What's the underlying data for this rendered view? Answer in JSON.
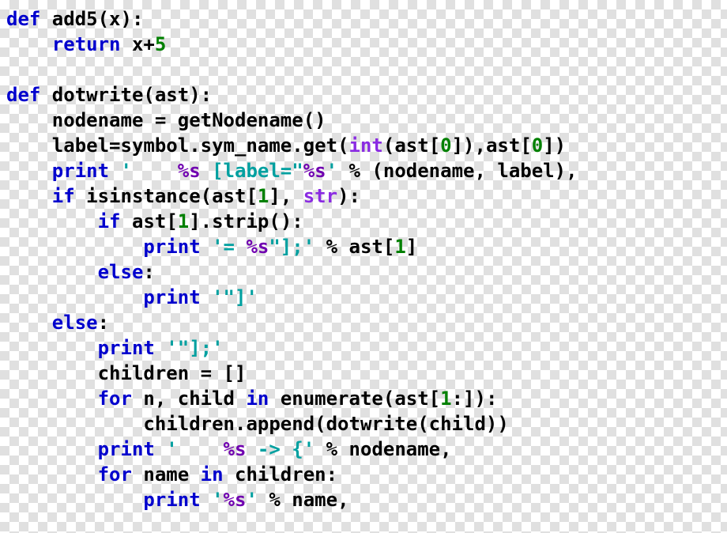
{
  "code": {
    "lines": [
      {
        "indent": 0,
        "tokens": [
          {
            "t": "def ",
            "c": "kw"
          },
          {
            "t": "add5",
            "c": "fn"
          },
          {
            "t": "(",
            "c": "par"
          },
          {
            "t": "x",
            "c": "fn"
          },
          {
            "t": ")",
            "c": "par"
          },
          {
            "t": ":",
            "c": "op"
          }
        ]
      },
      {
        "indent": 1,
        "tokens": [
          {
            "t": "return ",
            "c": "kw"
          },
          {
            "t": "x",
            "c": "fn"
          },
          {
            "t": "+",
            "c": "op"
          },
          {
            "t": "5",
            "c": "num"
          }
        ]
      },
      {
        "indent": 0,
        "tokens": []
      },
      {
        "indent": 0,
        "tokens": [
          {
            "t": "def ",
            "c": "kw"
          },
          {
            "t": "dotwrite",
            "c": "fn"
          },
          {
            "t": "(",
            "c": "par"
          },
          {
            "t": "ast",
            "c": "fn"
          },
          {
            "t": ")",
            "c": "par"
          },
          {
            "t": ":",
            "c": "op"
          }
        ]
      },
      {
        "indent": 1,
        "tokens": [
          {
            "t": "nodename ",
            "c": "fn"
          },
          {
            "t": "=",
            "c": "op"
          },
          {
            "t": " getNodename",
            "c": "fn"
          },
          {
            "t": "()",
            "c": "par"
          }
        ]
      },
      {
        "indent": 1,
        "tokens": [
          {
            "t": "label",
            "c": "fn"
          },
          {
            "t": "=",
            "c": "op"
          },
          {
            "t": "symbol",
            "c": "fn"
          },
          {
            "t": ".",
            "c": "op"
          },
          {
            "t": "sym_name",
            "c": "fn"
          },
          {
            "t": ".",
            "c": "op"
          },
          {
            "t": "get",
            "c": "fn"
          },
          {
            "t": "(",
            "c": "par"
          },
          {
            "t": "int",
            "c": "bi"
          },
          {
            "t": "(",
            "c": "par"
          },
          {
            "t": "ast",
            "c": "fn"
          },
          {
            "t": "[",
            "c": "par"
          },
          {
            "t": "0",
            "c": "num"
          },
          {
            "t": "]",
            "c": "par"
          },
          {
            "t": ")",
            "c": "par"
          },
          {
            "t": ",",
            "c": "op"
          },
          {
            "t": "ast",
            "c": "fn"
          },
          {
            "t": "[",
            "c": "par"
          },
          {
            "t": "0",
            "c": "num"
          },
          {
            "t": "]",
            "c": "par"
          },
          {
            "t": ")",
            "c": "par"
          }
        ]
      },
      {
        "indent": 1,
        "tokens": [
          {
            "t": "print ",
            "c": "kw"
          },
          {
            "t": "'    ",
            "c": "str"
          },
          {
            "t": "%s",
            "c": "fmt"
          },
          {
            "t": " [label=\"",
            "c": "str"
          },
          {
            "t": "%s",
            "c": "fmt"
          },
          {
            "t": "'",
            "c": "str"
          },
          {
            "t": " % ",
            "c": "op"
          },
          {
            "t": "(",
            "c": "par"
          },
          {
            "t": "nodename",
            "c": "fn"
          },
          {
            "t": ",",
            "c": "op"
          },
          {
            "t": " label",
            "c": "fn"
          },
          {
            "t": ")",
            "c": "par"
          },
          {
            "t": ",",
            "c": "op"
          }
        ]
      },
      {
        "indent": 1,
        "tokens": [
          {
            "t": "if ",
            "c": "kw"
          },
          {
            "t": "isinstance",
            "c": "fn"
          },
          {
            "t": "(",
            "c": "par"
          },
          {
            "t": "ast",
            "c": "fn"
          },
          {
            "t": "[",
            "c": "par"
          },
          {
            "t": "1",
            "c": "num"
          },
          {
            "t": "]",
            "c": "par"
          },
          {
            "t": ",",
            "c": "op"
          },
          {
            "t": " ",
            "c": "op"
          },
          {
            "t": "str",
            "c": "bi"
          },
          {
            "t": ")",
            "c": "par"
          },
          {
            "t": ":",
            "c": "op"
          }
        ]
      },
      {
        "indent": 2,
        "tokens": [
          {
            "t": "if ",
            "c": "kw"
          },
          {
            "t": "ast",
            "c": "fn"
          },
          {
            "t": "[",
            "c": "par"
          },
          {
            "t": "1",
            "c": "num"
          },
          {
            "t": "]",
            "c": "par"
          },
          {
            "t": ".",
            "c": "op"
          },
          {
            "t": "strip",
            "c": "fn"
          },
          {
            "t": "()",
            "c": "par"
          },
          {
            "t": ":",
            "c": "op"
          }
        ]
      },
      {
        "indent": 3,
        "tokens": [
          {
            "t": "print ",
            "c": "kw"
          },
          {
            "t": "'= ",
            "c": "str"
          },
          {
            "t": "%s",
            "c": "fmt"
          },
          {
            "t": "\"];'",
            "c": "str"
          },
          {
            "t": " % ",
            "c": "op"
          },
          {
            "t": "ast",
            "c": "fn"
          },
          {
            "t": "[",
            "c": "par"
          },
          {
            "t": "1",
            "c": "num"
          },
          {
            "t": "]",
            "c": "par"
          }
        ]
      },
      {
        "indent": 2,
        "tokens": [
          {
            "t": "else",
            "c": "kw"
          },
          {
            "t": ":",
            "c": "op"
          }
        ]
      },
      {
        "indent": 3,
        "tokens": [
          {
            "t": "print ",
            "c": "kw"
          },
          {
            "t": "'\"]'",
            "c": "str"
          }
        ]
      },
      {
        "indent": 1,
        "tokens": [
          {
            "t": "else",
            "c": "kw"
          },
          {
            "t": ":",
            "c": "op"
          }
        ]
      },
      {
        "indent": 2,
        "tokens": [
          {
            "t": "print ",
            "c": "kw"
          },
          {
            "t": "'\"];'",
            "c": "str"
          }
        ]
      },
      {
        "indent": 2,
        "tokens": [
          {
            "t": "children ",
            "c": "fn"
          },
          {
            "t": "=",
            "c": "op"
          },
          {
            "t": " []",
            "c": "par"
          }
        ]
      },
      {
        "indent": 2,
        "tokens": [
          {
            "t": "for ",
            "c": "kw"
          },
          {
            "t": "n",
            "c": "fn"
          },
          {
            "t": ",",
            "c": "op"
          },
          {
            "t": " child ",
            "c": "fn"
          },
          {
            "t": "in ",
            "c": "kw"
          },
          {
            "t": "enumerate",
            "c": "fn"
          },
          {
            "t": "(",
            "c": "par"
          },
          {
            "t": "ast",
            "c": "fn"
          },
          {
            "t": "[",
            "c": "par"
          },
          {
            "t": "1",
            "c": "num"
          },
          {
            "t": ":",
            "c": "op"
          },
          {
            "t": "]",
            "c": "par"
          },
          {
            "t": ")",
            "c": "par"
          },
          {
            "t": ":",
            "c": "op"
          }
        ]
      },
      {
        "indent": 3,
        "tokens": [
          {
            "t": "children",
            "c": "fn"
          },
          {
            "t": ".",
            "c": "op"
          },
          {
            "t": "append",
            "c": "fn"
          },
          {
            "t": "(",
            "c": "par"
          },
          {
            "t": "dotwrite",
            "c": "fn"
          },
          {
            "t": "(",
            "c": "par"
          },
          {
            "t": "child",
            "c": "fn"
          },
          {
            "t": ")",
            "c": "par"
          },
          {
            "t": ")",
            "c": "par"
          }
        ]
      },
      {
        "indent": 2,
        "tokens": [
          {
            "t": "print ",
            "c": "kw"
          },
          {
            "t": "'    ",
            "c": "str"
          },
          {
            "t": "%s",
            "c": "fmt"
          },
          {
            "t": " -> {'",
            "c": "str"
          },
          {
            "t": " % ",
            "c": "op"
          },
          {
            "t": "nodename",
            "c": "fn"
          },
          {
            "t": ",",
            "c": "op"
          }
        ]
      },
      {
        "indent": 2,
        "tokens": [
          {
            "t": "for ",
            "c": "kw"
          },
          {
            "t": "name ",
            "c": "fn"
          },
          {
            "t": "in ",
            "c": "kw"
          },
          {
            "t": "children",
            "c": "fn"
          },
          {
            "t": ":",
            "c": "op"
          }
        ]
      },
      {
        "indent": 3,
        "tokens": [
          {
            "t": "print ",
            "c": "kw"
          },
          {
            "t": "'",
            "c": "str"
          },
          {
            "t": "%s",
            "c": "fmt"
          },
          {
            "t": "'",
            "c": "str"
          },
          {
            "t": " % ",
            "c": "op"
          },
          {
            "t": "name",
            "c": "fn"
          },
          {
            "t": ",",
            "c": "op"
          }
        ]
      }
    ],
    "indent_unit": "    "
  }
}
